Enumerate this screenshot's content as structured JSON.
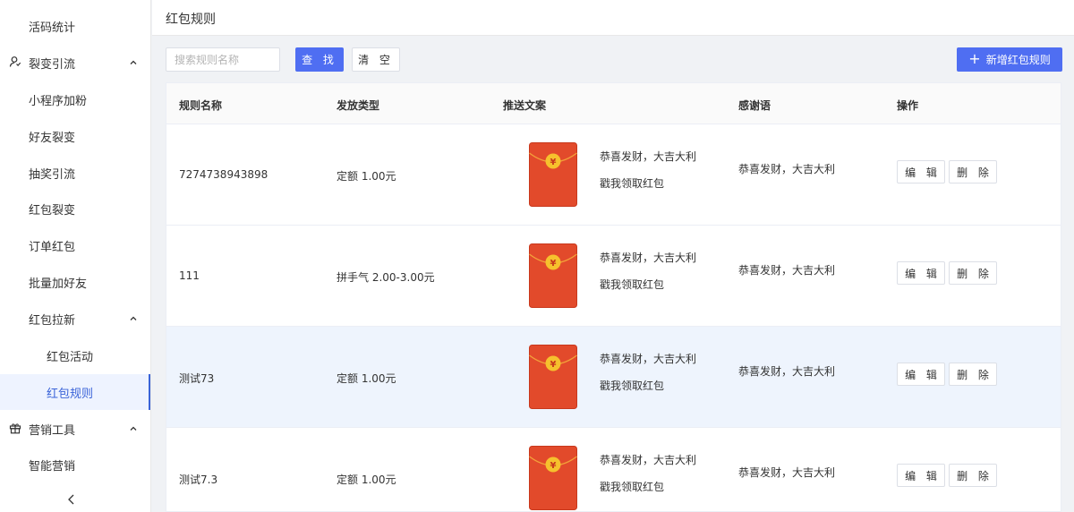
{
  "sidebar": {
    "items": [
      {
        "label": "活码统计"
      },
      {
        "label": "裂变引流"
      },
      {
        "label": "小程序加粉"
      },
      {
        "label": "好友裂变"
      },
      {
        "label": "抽奖引流"
      },
      {
        "label": "红包裂变"
      },
      {
        "label": "订单红包"
      },
      {
        "label": "批量加好友"
      },
      {
        "label": "红包拉新"
      },
      {
        "label": "红包活动"
      },
      {
        "label": "红包规则"
      },
      {
        "label": "营销工具"
      },
      {
        "label": "智能营销"
      }
    ],
    "collapse_icon": "chevron-left-icon"
  },
  "header": {
    "title": "红包规则"
  },
  "toolbar": {
    "search_placeholder": "搜索规则名称",
    "find_label": "查 找",
    "clear_label": "清 空",
    "add_label": "新增红包规则"
  },
  "table": {
    "columns": [
      "规则名称",
      "发放类型",
      "推送文案",
      "感谢语",
      "操作"
    ],
    "rows": [
      {
        "name": "7274738943898",
        "type": "定额 1.00元",
        "copy_line1": "恭喜发财，大吉大利",
        "copy_line2": "戳我领取红包",
        "thanks": "恭喜发财，大吉大利",
        "edit": "编 辑",
        "delete": "删 除"
      },
      {
        "name": "111",
        "type": "拼手气 2.00-3.00元",
        "copy_line1": "恭喜发财，大吉大利",
        "copy_line2": "戳我领取红包",
        "thanks": "恭喜发财，大吉大利",
        "edit": "编 辑",
        "delete": "删 除"
      },
      {
        "name": "测试73",
        "type": "定额 1.00元",
        "copy_line1": "恭喜发财，大吉大利",
        "copy_line2": "戳我领取红包",
        "thanks": "恭喜发财，大吉大利",
        "edit": "编 辑",
        "delete": "删 除"
      },
      {
        "name": "测试7.3",
        "type": "定额 1.00元",
        "copy_line1": "恭喜发财，大吉大利",
        "copy_line2": "戳我领取红包",
        "thanks": "恭喜发财，大吉大利",
        "edit": "编 辑",
        "delete": "删 除"
      }
    ],
    "envelope_symbol": "¥"
  },
  "colors": {
    "primary": "#4f6ef2",
    "active_menu": "#3a63d8",
    "envelope_red": "#e24a2b",
    "envelope_gold": "#f6c12d",
    "row_hover": "#eef4fd"
  }
}
